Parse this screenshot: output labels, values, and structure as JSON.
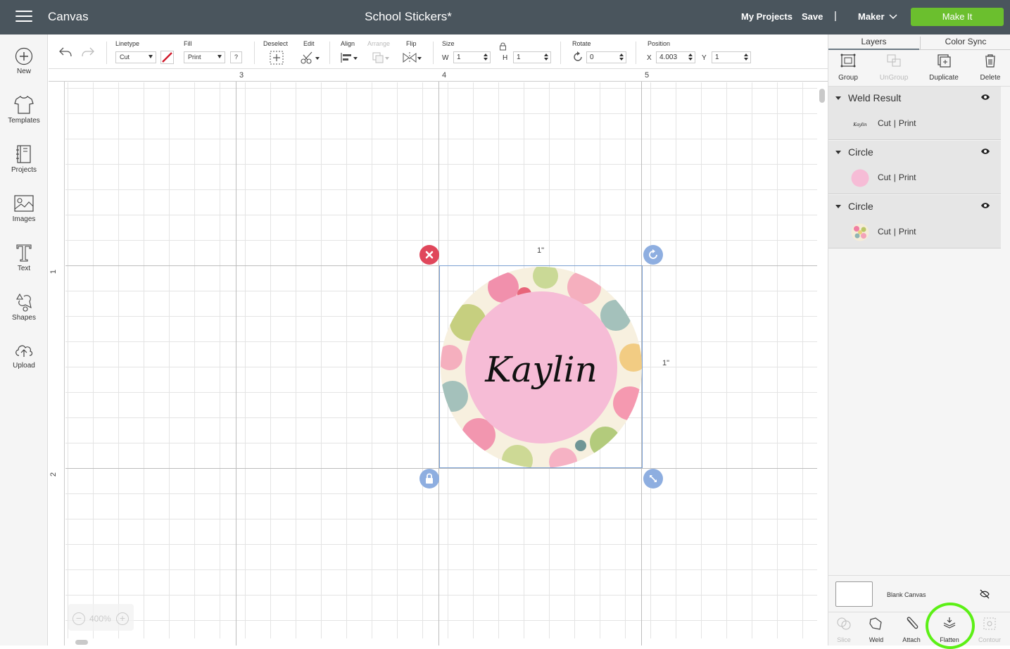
{
  "header": {
    "app_title": "Canvas",
    "document_title": "School Stickers*",
    "my_projects": "My Projects",
    "save": "Save",
    "separator": "|",
    "machine": "Maker",
    "make_it": "Make It",
    "accent_color": "#6bbf2e",
    "bar_color": "#4a555d"
  },
  "sidebar": {
    "items": [
      {
        "label": "New",
        "icon": "plus-circle-icon"
      },
      {
        "label": "Templates",
        "icon": "shirt-icon"
      },
      {
        "label": "Projects",
        "icon": "projects-icon"
      },
      {
        "label": "Images",
        "icon": "image-icon"
      },
      {
        "label": "Text",
        "icon": "text-icon"
      },
      {
        "label": "Shapes",
        "icon": "shapes-icon"
      },
      {
        "label": "Upload",
        "icon": "upload-icon"
      }
    ]
  },
  "toolbar": {
    "linetype_label": "Linetype",
    "linetype_value": "Cut",
    "fill_label": "Fill",
    "fill_value": "Print",
    "help": "?",
    "deselect_label": "Deselect",
    "edit_label": "Edit",
    "align_label": "Align",
    "arrange_label": "Arrange",
    "flip_label": "Flip",
    "size_label": "Size",
    "w_label": "W",
    "w_value": "1",
    "h_label": "H",
    "h_value": "1",
    "rotate_label": "Rotate",
    "rotate_value": "0",
    "position_label": "Position",
    "x_label": "X",
    "x_value": "4.003",
    "y_label": "Y",
    "y_value": "1"
  },
  "canvas": {
    "ruler_top": [
      "3",
      "4",
      "5"
    ],
    "ruler_left": [
      "1",
      "2"
    ],
    "width_label": "1\"",
    "height_label": "1\"",
    "sticker_text": "Kaylin",
    "zoom_value": "400%",
    "zoom_minus": "−",
    "zoom_plus": "+",
    "selection_color": "#7b9fd1",
    "sticker_pink": "#f6bcd6"
  },
  "right_panel": {
    "tabs": [
      "Layers",
      "Color Sync"
    ],
    "tools": [
      {
        "label": "Group",
        "enabled": true
      },
      {
        "label": "UnGroup",
        "enabled": false
      },
      {
        "label": "Duplicate",
        "enabled": true
      },
      {
        "label": "Delete",
        "enabled": true
      }
    ],
    "layers": [
      {
        "title": "Weld Result",
        "thumb_text": "Kaylin",
        "cut": "Cut",
        "sep": "|",
        "print": "Print"
      },
      {
        "title": "Circle",
        "cut": "Cut",
        "sep": "|",
        "print": "Print",
        "color": "#f6bcd6"
      },
      {
        "title": "Circle",
        "cut": "Cut",
        "sep": "|",
        "print": "Print"
      }
    ],
    "blank_canvas": "Blank Canvas",
    "bottom_tools": [
      {
        "label": "Slice",
        "enabled": false
      },
      {
        "label": "Weld",
        "enabled": true
      },
      {
        "label": "Attach",
        "enabled": true
      },
      {
        "label": "Flatten",
        "enabled": true
      },
      {
        "label": "Contour",
        "enabled": false
      }
    ],
    "highlight_color": "#5cf016"
  }
}
